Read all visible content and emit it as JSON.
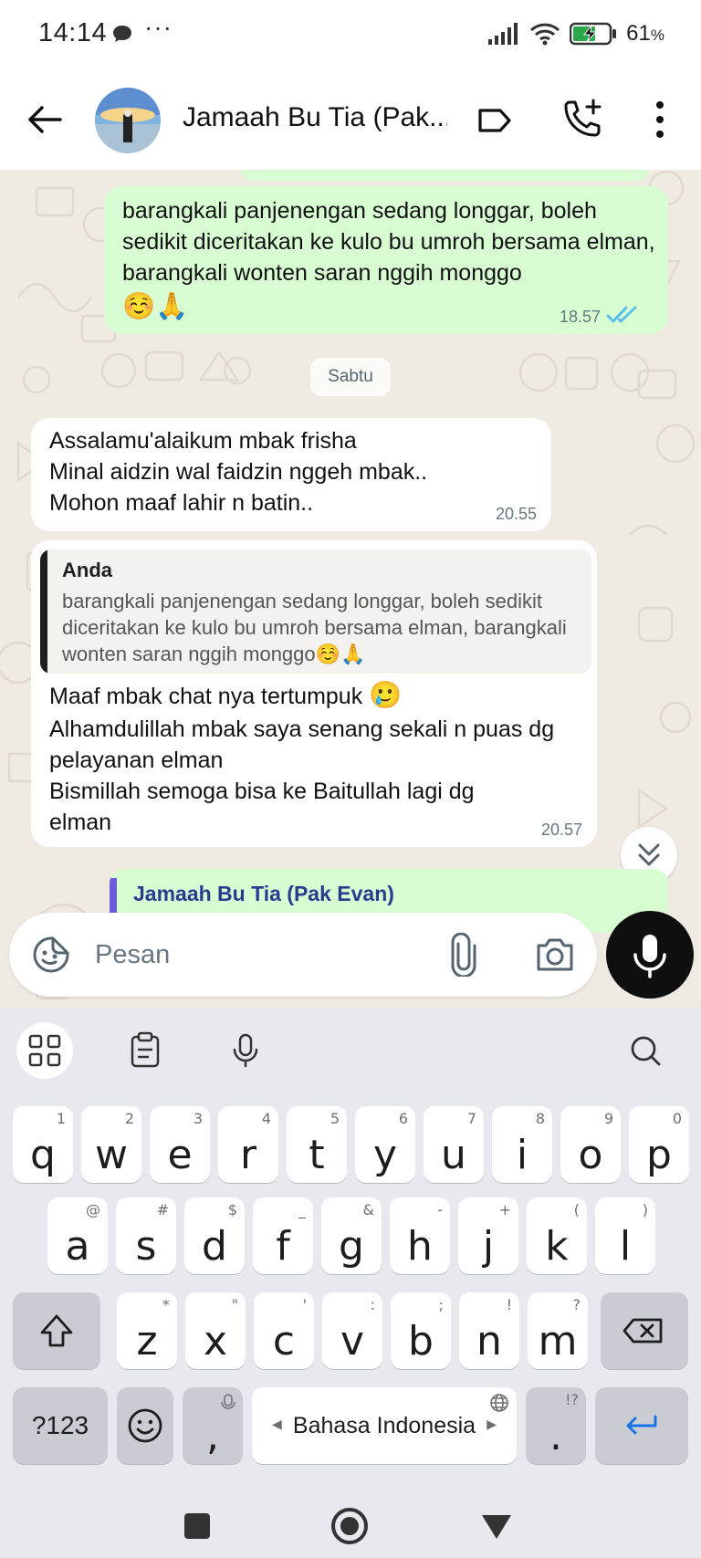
{
  "status_bar": {
    "time": "14:14",
    "dots": "···",
    "battery_percent": "61",
    "battery_unit": "%"
  },
  "header": {
    "chat_title": "Jamaah Bu Tia (Pak..."
  },
  "messages": {
    "out_1": {
      "text": "barangkali panjenengan sedang longgar, boleh sedikit diceritakan ke kulo bu umroh bersama elman, barangkali wonten saran nggih monggo",
      "emoji": "☺️🙏",
      "time": "18.57"
    },
    "date_chip": "Sabtu",
    "in_1": {
      "line1": "Assalamu'alaikum mbak frisha",
      "line2": "Minal aidzin wal faidzin nggeh mbak..",
      "line3": "Mohon maaf lahir n batin..",
      "time": "20.55"
    },
    "in_2": {
      "quote_author": "Anda",
      "quote_text": "barangkali panjenengan sedang longgar, boleh sedikit diceritakan ke kulo bu umroh bersama elman, barangkali wonten saran nggih monggo☺️🙏",
      "line1": "Maaf mbak chat nya tertumpuk",
      "line1_emoji": "🥲",
      "line2": "Alhamdulillah mbak saya senang sekali n puas dg pelayanan elman",
      "line3": "Bismillah semoga bisa ke Baitullah lagi dg elman",
      "time": "20.57"
    },
    "partial_reply_name": "Jamaah Bu Tia (Pak Evan)"
  },
  "input": {
    "placeholder": "Pesan"
  },
  "keyboard": {
    "row1": [
      {
        "k": "q",
        "s": "1"
      },
      {
        "k": "w",
        "s": "2"
      },
      {
        "k": "e",
        "s": "3"
      },
      {
        "k": "r",
        "s": "4"
      },
      {
        "k": "t",
        "s": "5"
      },
      {
        "k": "y",
        "s": "6"
      },
      {
        "k": "u",
        "s": "7"
      },
      {
        "k": "i",
        "s": "8"
      },
      {
        "k": "o",
        "s": "9"
      },
      {
        "k": "p",
        "s": "0"
      }
    ],
    "row2": [
      {
        "k": "a",
        "s": "@"
      },
      {
        "k": "s",
        "s": "#"
      },
      {
        "k": "d",
        "s": "$"
      },
      {
        "k": "f",
        "s": "_"
      },
      {
        "k": "g",
        "s": "&"
      },
      {
        "k": "h",
        "s": "-"
      },
      {
        "k": "j",
        "s": "+"
      },
      {
        "k": "k",
        "s": "("
      },
      {
        "k": "l",
        "s": ")"
      }
    ],
    "row3": [
      {
        "k": "z",
        "s": "*"
      },
      {
        "k": "x",
        "s": "\""
      },
      {
        "k": "c",
        "s": "'"
      },
      {
        "k": "v",
        "s": ":"
      },
      {
        "k": "b",
        "s": ";"
      },
      {
        "k": "n",
        "s": "!"
      },
      {
        "k": "m",
        "s": "?"
      }
    ],
    "symbols_label": "?123",
    "comma": ",",
    "period": ".",
    "period_sup": "!?",
    "space_label": "Bahasa Indonesia"
  }
}
